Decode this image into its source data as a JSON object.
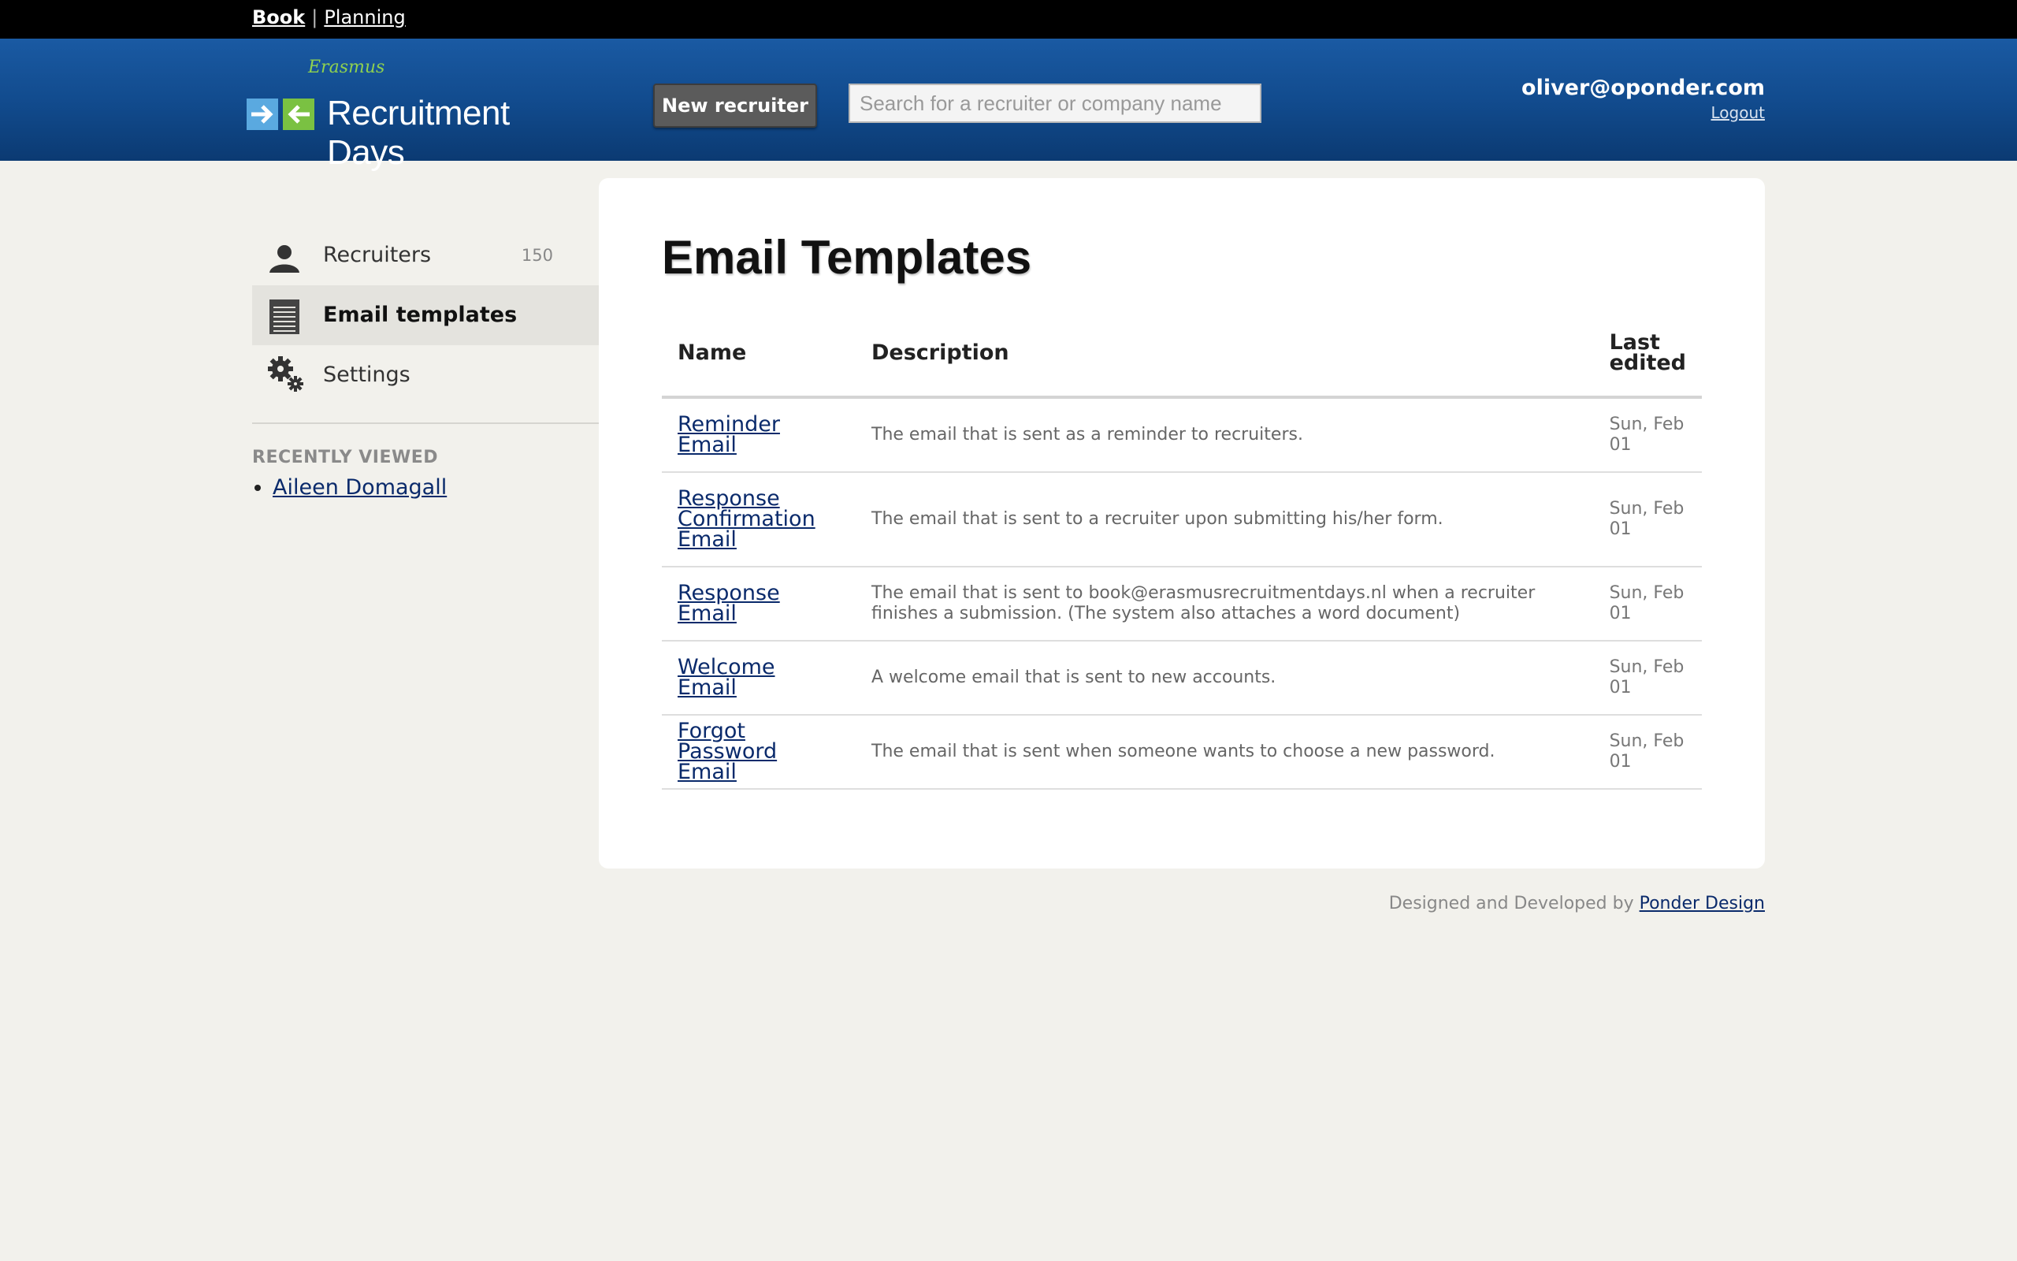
{
  "topnav": {
    "book": "Book",
    "separator": "|",
    "planning": "Planning"
  },
  "header": {
    "logo_script": "Erasmus",
    "logo_title": "Recruitment Days",
    "new_recruiter": "New recruiter",
    "search_placeholder": "Search for a recruiter or company name",
    "user_email": "oliver@oponder.com",
    "logout": "Logout"
  },
  "sidebar": {
    "items": [
      {
        "label": "Recruiters",
        "count": "150",
        "icon": "person-icon"
      },
      {
        "label": "Email templates",
        "count": "",
        "icon": "notepad-icon",
        "active": true
      },
      {
        "label": "Settings",
        "count": "",
        "icon": "gears-icon"
      }
    ],
    "recent_title": "RECENTLY VIEWED",
    "recent": [
      "Aileen Domagall"
    ]
  },
  "main": {
    "title": "Email Templates",
    "columns": [
      "Name",
      "Description",
      "Last edited"
    ],
    "rows": [
      {
        "name": "Reminder Email",
        "description": "The email that is sent as a reminder to recruiters.",
        "date": "Sun, Feb 01"
      },
      {
        "name": "Response Confirmation Email",
        "description": "The email that is sent to a recruiter upon submitting his/her form.",
        "date": "Sun, Feb 01"
      },
      {
        "name": "Response Email",
        "description": "The email that is sent to book@erasmusrecruitmentdays.nl when a recruiter finishes a submission. (The system also attaches a word document)",
        "date": "Sun, Feb 01"
      },
      {
        "name": "Welcome Email",
        "description": "A welcome email that is sent to new accounts.",
        "date": "Sun, Feb 01"
      },
      {
        "name": "Forgot Password Email",
        "description": "The email that is sent when someone wants to choose a new password.",
        "date": "Sun, Feb 01"
      }
    ]
  },
  "footer": {
    "text": "Designed and Developed by",
    "link": "Ponder Design"
  },
  "colors": {
    "header_blue": "#114a8c",
    "link": "#0a2a6b",
    "background": "#f2f1ec"
  }
}
